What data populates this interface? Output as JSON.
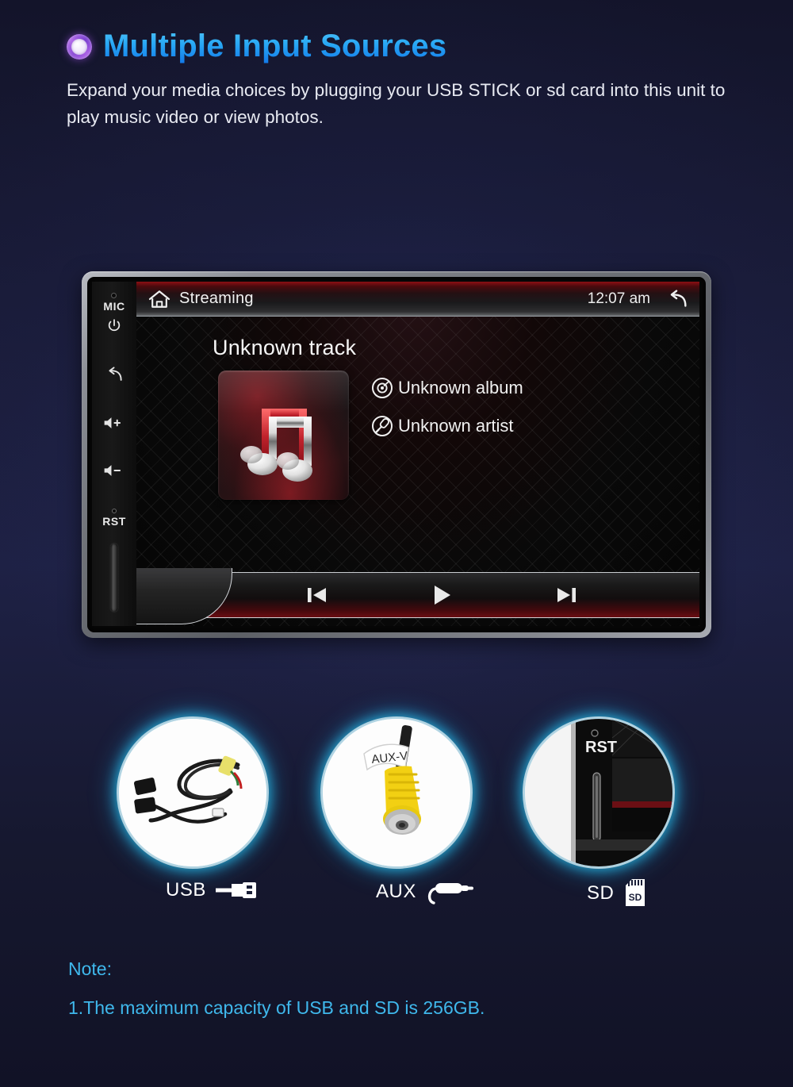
{
  "header": {
    "bullet_icon": "ring-bullet-icon",
    "title": "Multiple Input Sources",
    "subtitle": "Expand your media choices by plugging your USB STICK or sd card into this unit to play music video  or view photos."
  },
  "device": {
    "hardware_buttons": [
      {
        "id": "mic",
        "label": "MIC",
        "icon": "microphone-hole-icon"
      },
      {
        "id": "power",
        "label": "",
        "icon": "power-icon"
      },
      {
        "id": "back",
        "label": "",
        "icon": "back-arrow-icon"
      },
      {
        "id": "volume-up",
        "label": "",
        "icon": "volume-up-icon"
      },
      {
        "id": "volume-down",
        "label": "",
        "icon": "volume-down-icon"
      },
      {
        "id": "reset",
        "label": "RST",
        "icon": "reset-pinhole-icon"
      },
      {
        "id": "sd-slot",
        "label": "",
        "icon": "sd-card-slot-icon"
      }
    ],
    "screen": {
      "topbar": {
        "home_icon": "home-icon",
        "title": "Streaming",
        "time": "12:07 am",
        "back_icon": "return-arrow-icon"
      },
      "now_playing": {
        "track": "Unknown track",
        "album_art_icon": "music-note-artwork",
        "meta": [
          {
            "icon": "disc-icon",
            "text": "Unknown album"
          },
          {
            "icon": "microphone-icon",
            "text": "Unknown artist"
          }
        ]
      },
      "transport": [
        {
          "id": "previous",
          "icon": "previous-track-icon"
        },
        {
          "id": "play",
          "icon": "play-icon"
        },
        {
          "id": "next",
          "icon": "next-track-icon"
        }
      ]
    }
  },
  "gallery": [
    {
      "id": "usb",
      "photo": "usb-cable-photo",
      "alt": "USB cable harness"
    },
    {
      "id": "aux",
      "photo": "aux-rca-connector-photo",
      "alt": "Yellow RCA AUX-V connector",
      "tag_text": "AUX-V"
    },
    {
      "id": "sd",
      "photo": "sd-slot-closeup-photo",
      "alt": "SD card slot close-up",
      "tag_text": "RST"
    }
  ],
  "labels": [
    {
      "id": "usb",
      "text": "USB",
      "icon": "usb-plug-icon"
    },
    {
      "id": "aux",
      "text": "AUX",
      "icon": "aux-jack-icon"
    },
    {
      "id": "sd",
      "text": "SD",
      "icon": "sd-card-icon"
    }
  ],
  "note": {
    "heading": "Note:",
    "line1": "1.The maximum capacity of USB and SD is 256GB."
  },
  "colors": {
    "background": "#13142a",
    "title_accent": "#29a9f5",
    "note_accent": "#3fb8ec",
    "ring_glow": "#28bee b",
    "bullet": "#8d4fd6"
  }
}
